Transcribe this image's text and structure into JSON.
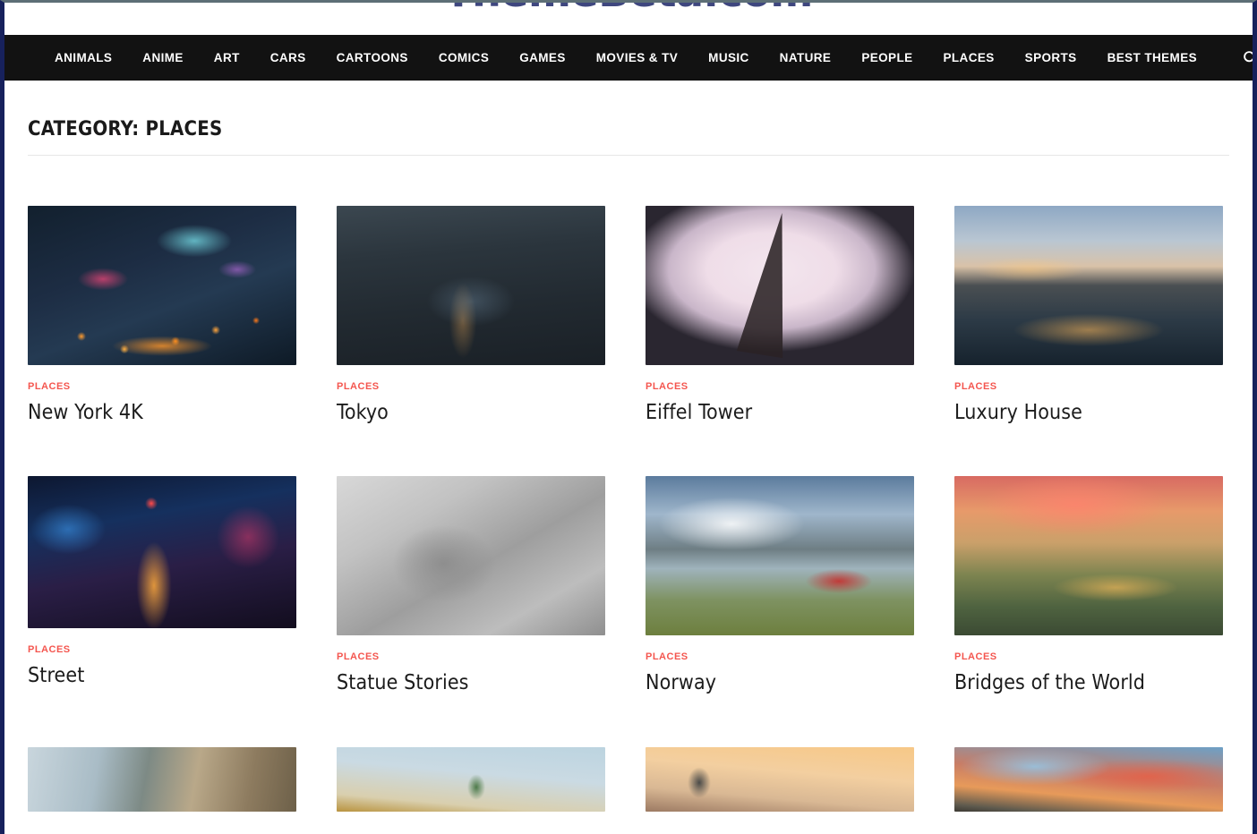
{
  "site": {
    "logo_text": "ThemeBeta.com"
  },
  "nav": {
    "items": [
      {
        "label": "ANIMALS"
      },
      {
        "label": "ANIME"
      },
      {
        "label": "ART"
      },
      {
        "label": "CARS"
      },
      {
        "label": "CARTOONS"
      },
      {
        "label": "COMICS"
      },
      {
        "label": "GAMES"
      },
      {
        "label": "MOVIES & TV"
      },
      {
        "label": "MUSIC"
      },
      {
        "label": "NATURE"
      },
      {
        "label": "PEOPLE"
      },
      {
        "label": "PLACES"
      },
      {
        "label": "SPORTS"
      },
      {
        "label": "BEST THEMES"
      }
    ],
    "search_icon": "search-icon"
  },
  "page": {
    "title": "CATEGORY: PLACES",
    "accent_color": "#f4564f",
    "nav_background": "#121212",
    "logo_color": "#3f477f",
    "window_border_color": "#17215c"
  },
  "cards": [
    {
      "category": "PLACES",
      "title": "New York 4K",
      "art": "img-newyork",
      "size": "full"
    },
    {
      "category": "PLACES",
      "title": "Tokyo",
      "art": "img-tokyo",
      "size": "full"
    },
    {
      "category": "PLACES",
      "title": "Eiffel Tower",
      "art": "img-eiffel",
      "size": "full"
    },
    {
      "category": "PLACES",
      "title": "Luxury House",
      "art": "img-luxury",
      "size": "full"
    },
    {
      "category": "PLACES",
      "title": "Street",
      "art": "img-street",
      "size": "short"
    },
    {
      "category": "PLACES",
      "title": "Statue Stories",
      "art": "img-statue",
      "size": "full"
    },
    {
      "category": "PLACES",
      "title": "Norway",
      "art": "img-norway",
      "size": "full"
    },
    {
      "category": "PLACES",
      "title": "Bridges of the World",
      "art": "img-bridges",
      "size": "full"
    },
    {
      "category": "",
      "title": "",
      "art": "img-waterfall",
      "size": "cropped"
    },
    {
      "category": "",
      "title": "",
      "art": "img-dome",
      "size": "cropped"
    },
    {
      "category": "",
      "title": "",
      "art": "img-budapest",
      "size": "cropped"
    },
    {
      "category": "",
      "title": "",
      "art": "img-sunset",
      "size": "cropped"
    }
  ]
}
